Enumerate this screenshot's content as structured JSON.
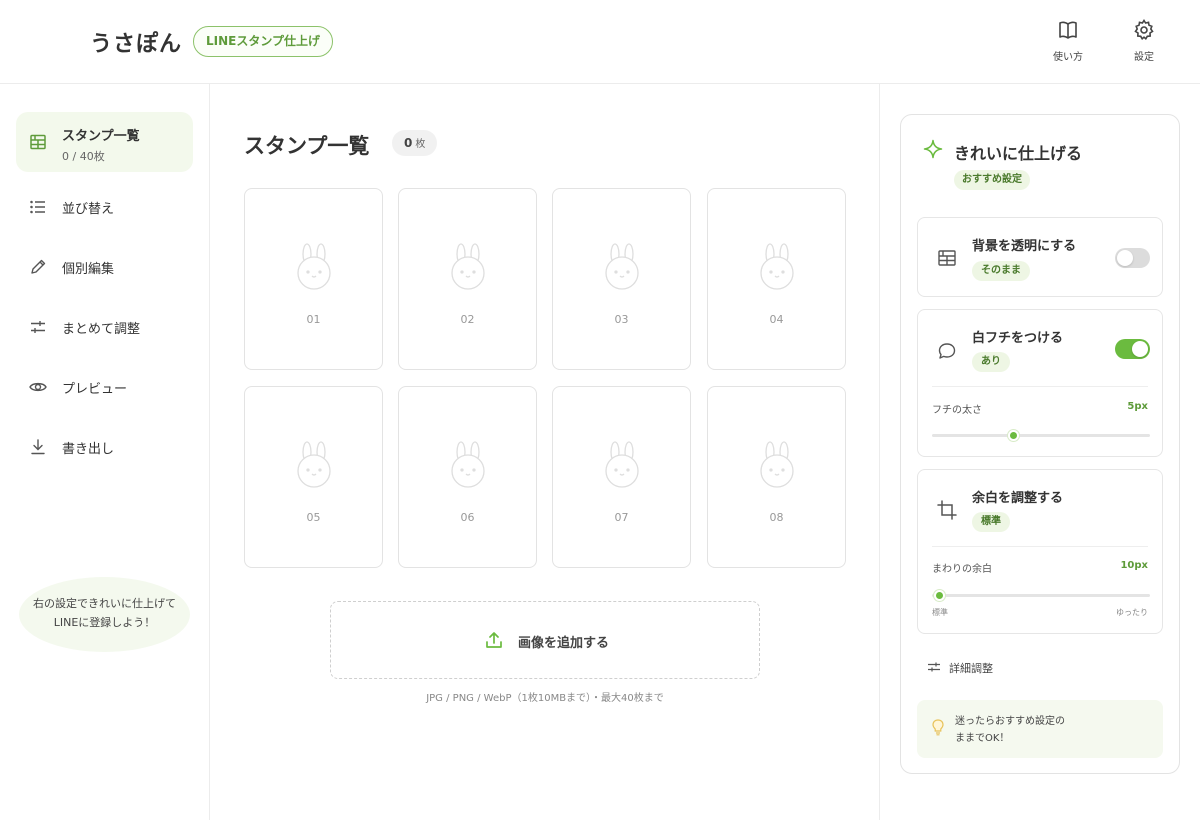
{
  "app": {
    "name": "うさぽん",
    "badge": "LINEスタンプ仕上げ"
  },
  "header_actions": [
    {
      "label": "使い方",
      "icon": "book-icon"
    },
    {
      "label": "設定",
      "icon": "gear-icon"
    }
  ],
  "sidebar": {
    "items": [
      {
        "label": "スタンプ一覧",
        "sub": "0 / 40枚",
        "icon": "grid-icon",
        "active": true
      },
      {
        "label": "並び替え",
        "icon": "list-icon"
      },
      {
        "label": "個別編集",
        "icon": "pencil-icon"
      },
      {
        "label": "まとめて調整",
        "icon": "sliders-icon"
      },
      {
        "label": "プレビュー",
        "icon": "eye-icon"
      },
      {
        "label": "書き出し",
        "icon": "download-icon"
      }
    ],
    "tip": {
      "line1": "右の設定できれいに仕上げて",
      "line2": "LINEに登録しよう！"
    }
  },
  "main": {
    "title": "スタンプ一覧",
    "count": "0",
    "count_unit": "枚",
    "slots": [
      "01",
      "02",
      "03",
      "04",
      "05",
      "06",
      "07",
      "08"
    ],
    "upload_label": "画像を追加する",
    "upload_note": "JPG / PNG / WebP（1枚10MBまで）・最大40枚まで"
  },
  "panel": {
    "title": "きれいに仕上げる",
    "badge": "おすすめ設定",
    "options": {
      "transparent": {
        "title": "背景を透明にする",
        "badge": "そのまま",
        "enabled": false
      },
      "border": {
        "title": "白フチをつける",
        "badge": "あり",
        "enabled": true,
        "slider_label": "フチの太さ",
        "slider_value": "5px",
        "slider_fraction": 0.37
      },
      "margin": {
        "title": "余白を調整する",
        "badge": "標準",
        "slider_label": "まわりの余白",
        "slider_value": "10px",
        "slider_fraction": 0.03,
        "min_label": "標準",
        "max_label": "ゆったり"
      }
    },
    "detail_label": "詳細調整",
    "hint": {
      "line1": "迷ったらおすすめ設定の",
      "line2": "ままでOK！"
    }
  },
  "colors": {
    "accent": "#6bbb3f",
    "accent_dark": "#5e9b3a",
    "accent_light": "#eef6e4",
    "border": "#e3e3e3"
  }
}
